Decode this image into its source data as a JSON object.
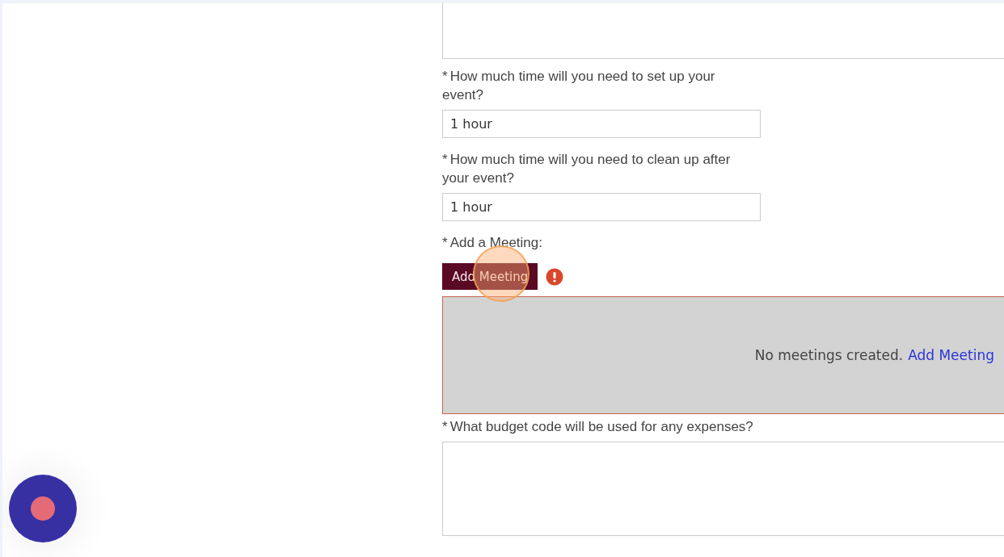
{
  "form": {
    "fields": [
      {
        "kind": "textarea"
      },
      {
        "kind": "input",
        "required": true,
        "label": "How much time will you need to set up your event?",
        "value": "1 hour"
      },
      {
        "kind": "input",
        "required": true,
        "label": "How much time will you need to clean up after your event?",
        "value": "1 hour"
      },
      {
        "kind": "meetings",
        "required": true,
        "label": "Add a Meeting:",
        "button": "Add Meeting",
        "error": true,
        "empty_text": "No meetings created.",
        "link": "Add Meeting"
      },
      {
        "kind": "textarea",
        "required": true,
        "label": "What budget code will be used for any expenses?"
      }
    ]
  },
  "required_mark": "*"
}
